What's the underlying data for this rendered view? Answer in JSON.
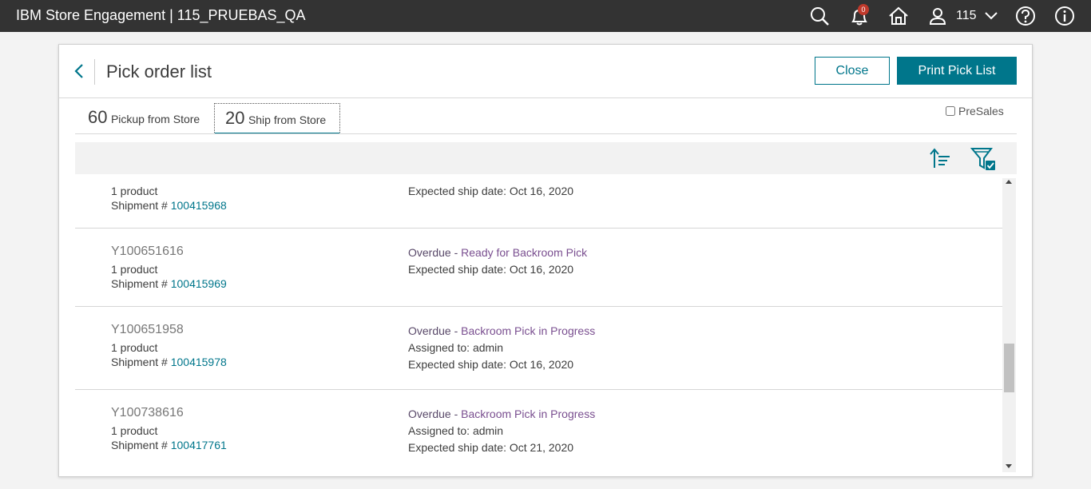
{
  "header": {
    "title": "IBM Store Engagement | 115_PRUEBAS_QA",
    "notification_count": "0",
    "store": "115",
    "icons": [
      "search-icon",
      "bell-icon",
      "home-icon",
      "user-icon",
      "chevron-down-icon",
      "help-icon",
      "info-icon"
    ]
  },
  "page": {
    "title": "Pick order list",
    "close_label": "Close",
    "print_label": "Print Pick List"
  },
  "tabs": [
    {
      "count": "60",
      "label": "Pickup from Store",
      "selected": false
    },
    {
      "count": "20",
      "label": "Ship from Store",
      "selected": true
    }
  ],
  "presales": {
    "label": "PreSales",
    "checked": false
  },
  "colors": {
    "topbar": "#333333",
    "accent": "#00768b",
    "status": "#7a4f90"
  },
  "rows": [
    {
      "order": "",
      "products": "1 product",
      "shipment_prefix": "Shipment # ",
      "shipment": "100415968",
      "overdue": "",
      "status": "",
      "assigned": "",
      "expected": "Expected ship date: Oct 16, 2020"
    },
    {
      "order": "Y100651616",
      "products": "1 product",
      "shipment_prefix": "Shipment # ",
      "shipment": "100415969",
      "overdue": "Overdue - ",
      "status": "Ready for Backroom Pick",
      "assigned": "",
      "expected": "Expected ship date: Oct 16, 2020"
    },
    {
      "order": "Y100651958",
      "products": "1 product",
      "shipment_prefix": "Shipment # ",
      "shipment": "100415978",
      "overdue": "Overdue - ",
      "status": "Backroom Pick in Progress",
      "assigned": "Assigned to: admin",
      "expected": "Expected ship date: Oct 16, 2020"
    },
    {
      "order": "Y100738616",
      "products": "1 product",
      "shipment_prefix": "Shipment # ",
      "shipment": "100417761",
      "overdue": "Overdue - ",
      "status": "Backroom Pick in Progress",
      "assigned": "Assigned to: admin",
      "expected": "Expected ship date: Oct 21, 2020"
    }
  ]
}
